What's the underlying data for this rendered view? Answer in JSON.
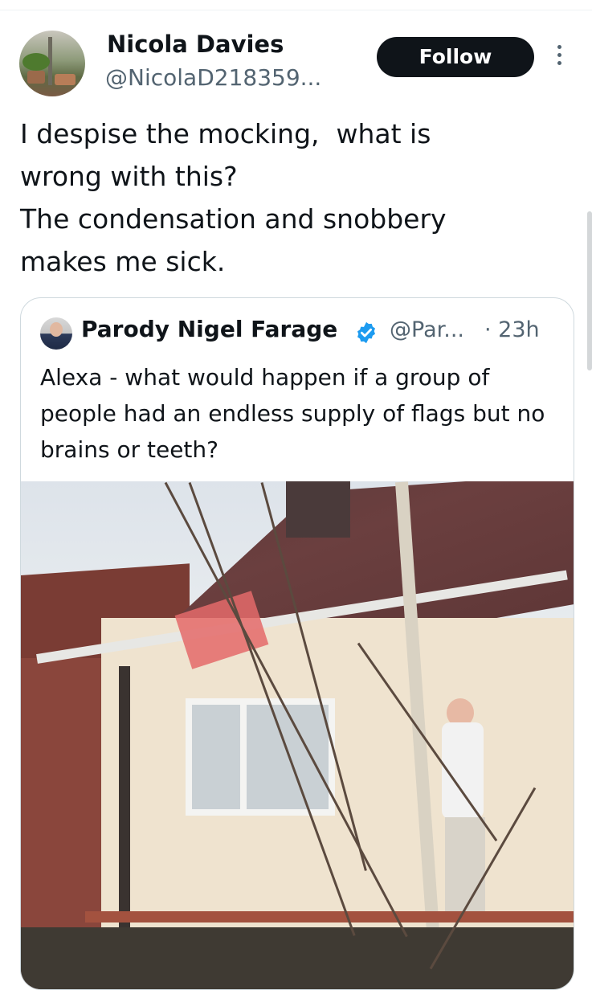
{
  "tweet": {
    "author_name": "Nicola Davies",
    "author_handle": "@NicolaD218359...",
    "follow_label": "Follow",
    "text": "I despise the mocking,  what is\nwrong with this?\nThe condensation and snobbery\nmakes me sick."
  },
  "quote": {
    "author_name": "Parody Nigel Farage",
    "author_handle": "@Par...",
    "time": "· 23h",
    "text": "Alexa - what would happen if a group of people had an endless supply of flags but no brains or teeth?",
    "verified_color": "#1d9bf0"
  },
  "icons": {
    "more": "more-vertical-icon",
    "verified": "verified-badge-icon"
  },
  "colors": {
    "text": "#0f1419",
    "secondary": "#536471",
    "follow_bg": "#0f1419",
    "border": "#cfd9de"
  }
}
